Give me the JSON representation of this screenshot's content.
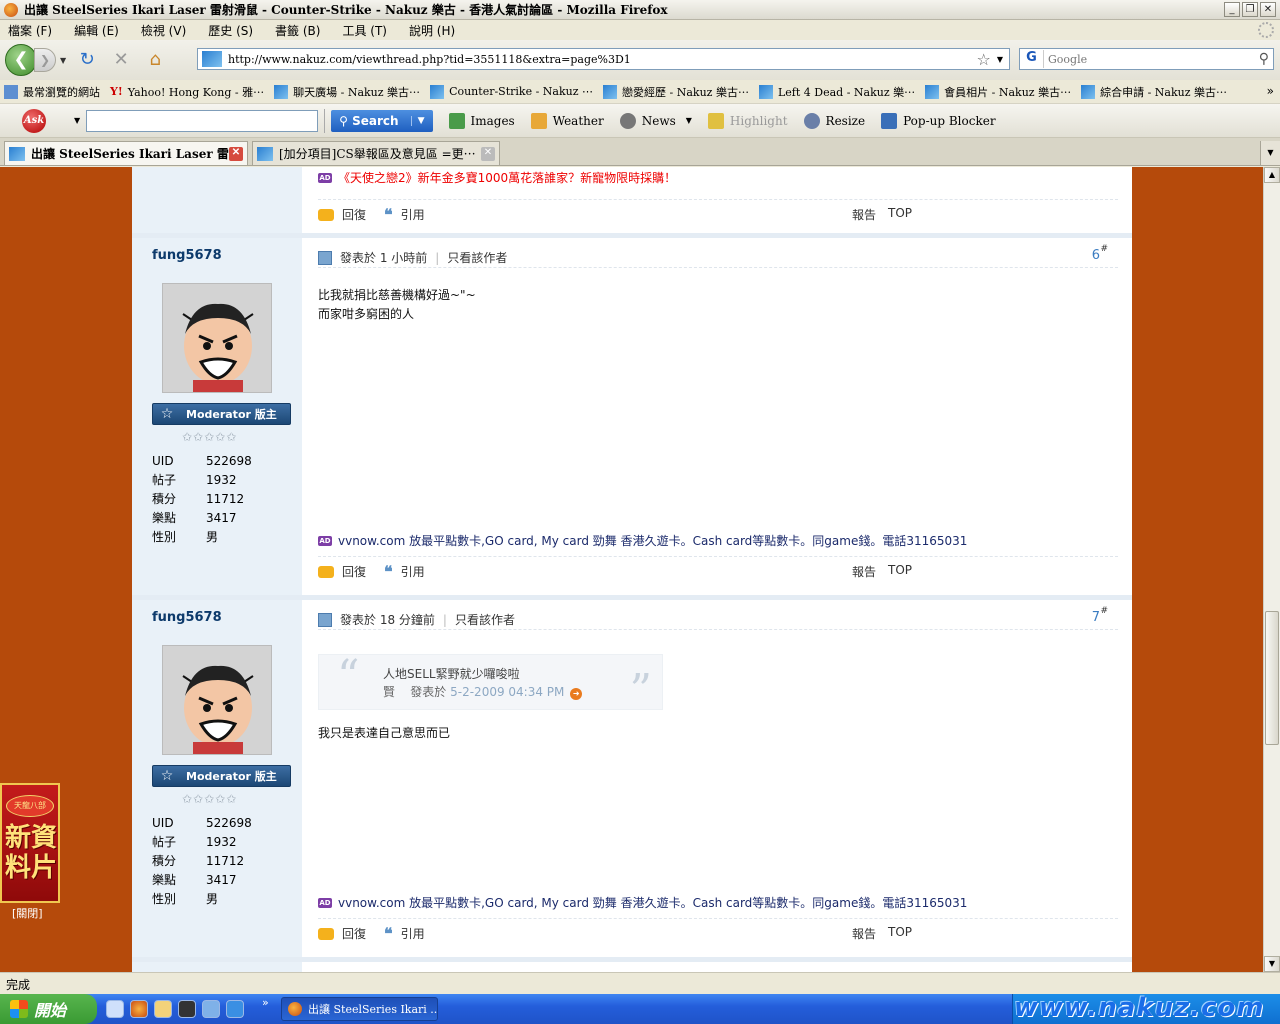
{
  "window": {
    "title": "出讓 SteelSeries Ikari Laser 雷射滑鼠 - Counter-Strike - Nakuz 樂古 - 香港人氣討論區 - Mozilla Firefox",
    "minimize": "_",
    "maximize": "❐",
    "close": "✕"
  },
  "menubar": {
    "items": [
      "檔案 (F)",
      "編輯 (E)",
      "檢視 (V)",
      "歷史 (S)",
      "書籤 (B)",
      "工具 (T)",
      "說明 (H)"
    ]
  },
  "navbar": {
    "back": "❮",
    "forward": "❯",
    "reload": "↻",
    "stop": "✕",
    "home": "⌂",
    "url": "http://www.nakuz.com/viewthread.php?tid=3551118&extra=page%3D1",
    "search_engine": "G",
    "search_placeholder": "Google"
  },
  "bookmarks": {
    "items": [
      {
        "label": "最常瀏覽的網站",
        "icon": "folder"
      },
      {
        "label": "Yahoo! Hong Kong - 雅⋯",
        "icon": "yahoo"
      },
      {
        "label": "聊天廣場 - Nakuz 樂古⋯",
        "icon": "site"
      },
      {
        "label": "Counter-Strike - Nakuz ⋯",
        "icon": "site"
      },
      {
        "label": "戀愛經歷 - Nakuz 樂古⋯",
        "icon": "site"
      },
      {
        "label": "Left 4 Dead - Nakuz 樂⋯",
        "icon": "site"
      },
      {
        "label": "會員相片 - Nakuz 樂古⋯",
        "icon": "site"
      },
      {
        "label": "綜合申請 - Nakuz 樂古⋯",
        "icon": "site"
      }
    ],
    "more": "»"
  },
  "asktoolbar": {
    "logo": "Ask",
    "search_label": "Search",
    "items": [
      {
        "label": "Images",
        "color": "#4a9b4a"
      },
      {
        "label": "Weather",
        "color": "#e8a838"
      },
      {
        "label": "News",
        "color": "#777777"
      },
      {
        "label": "Highlight",
        "color": "#e0c040"
      },
      {
        "label": "Resize",
        "color": "#6a7fa8"
      },
      {
        "label": "Pop-up Blocker",
        "color": "#3a6fb8"
      }
    ]
  },
  "tabs": [
    {
      "label": "出讓 SteelSeries Ikari Laser 雷射⋯",
      "active": true
    },
    {
      "label": "[加分項目]CS舉報區及意見區 =更⋯",
      "active": false
    }
  ],
  "prev_post": {
    "ad": "《天使之戀2》新年金多寶1000萬花落誰家？新寵物限時採購！"
  },
  "actions": {
    "reply": "回復",
    "quote": "引用",
    "report": "報告",
    "top": "TOP"
  },
  "posts": [
    {
      "author": "fung5678",
      "badge": "Moderator 版主",
      "stars": "✩✩✩✩✩",
      "stats": [
        {
          "k": "UID",
          "v": "522698"
        },
        {
          "k": "帖子",
          "v": "1932"
        },
        {
          "k": "積分",
          "v": "11712"
        },
        {
          "k": "樂點",
          "v": "3417"
        },
        {
          "k": "性別",
          "v": "男"
        }
      ],
      "posted": "發表於 1 小時前",
      "author_only": "只看該作者",
      "floor": "6",
      "lines": [
        "比我就捐比慈善機構好過~\"~",
        "而家咁多窮困的人"
      ],
      "ad": "vvnow.com 放最平點數卡,GO card, My card 勁舞 香港久遊卡。Cash card等點數卡。同game錢。電話31165031"
    },
    {
      "author": "fung5678",
      "badge": "Moderator 版主",
      "stars": "✩✩✩✩✩",
      "stats": [
        {
          "k": "UID",
          "v": "522698"
        },
        {
          "k": "帖子",
          "v": "1932"
        },
        {
          "k": "積分",
          "v": "11712"
        },
        {
          "k": "樂點",
          "v": "3417"
        },
        {
          "k": "性別",
          "v": "男"
        }
      ],
      "posted": "發表於 18 分鐘前",
      "author_only": "只看該作者",
      "floor": "7",
      "quote": {
        "text": "人地SELL緊野就少囉唆啦",
        "by": "賢",
        "posted_prefix": "發表於",
        "date": "5-2-2009 04:34 PM"
      },
      "lines": [
        "我只是表達自己意思而已"
      ],
      "ad": "vvnow.com 放最平點數卡,GO card, My card 勁舞 香港久遊卡。Cash card等點數卡。同game錢。電話31165031"
    }
  ],
  "sidead": {
    "top": "天龍八部",
    "main": "新資料片",
    "close": "[關閉]"
  },
  "status": "完成",
  "taskbar": {
    "start": "開始",
    "more": "»",
    "window": "出讓 SteelSeries Ikari ..."
  },
  "watermark": "www.nakuz.com"
}
